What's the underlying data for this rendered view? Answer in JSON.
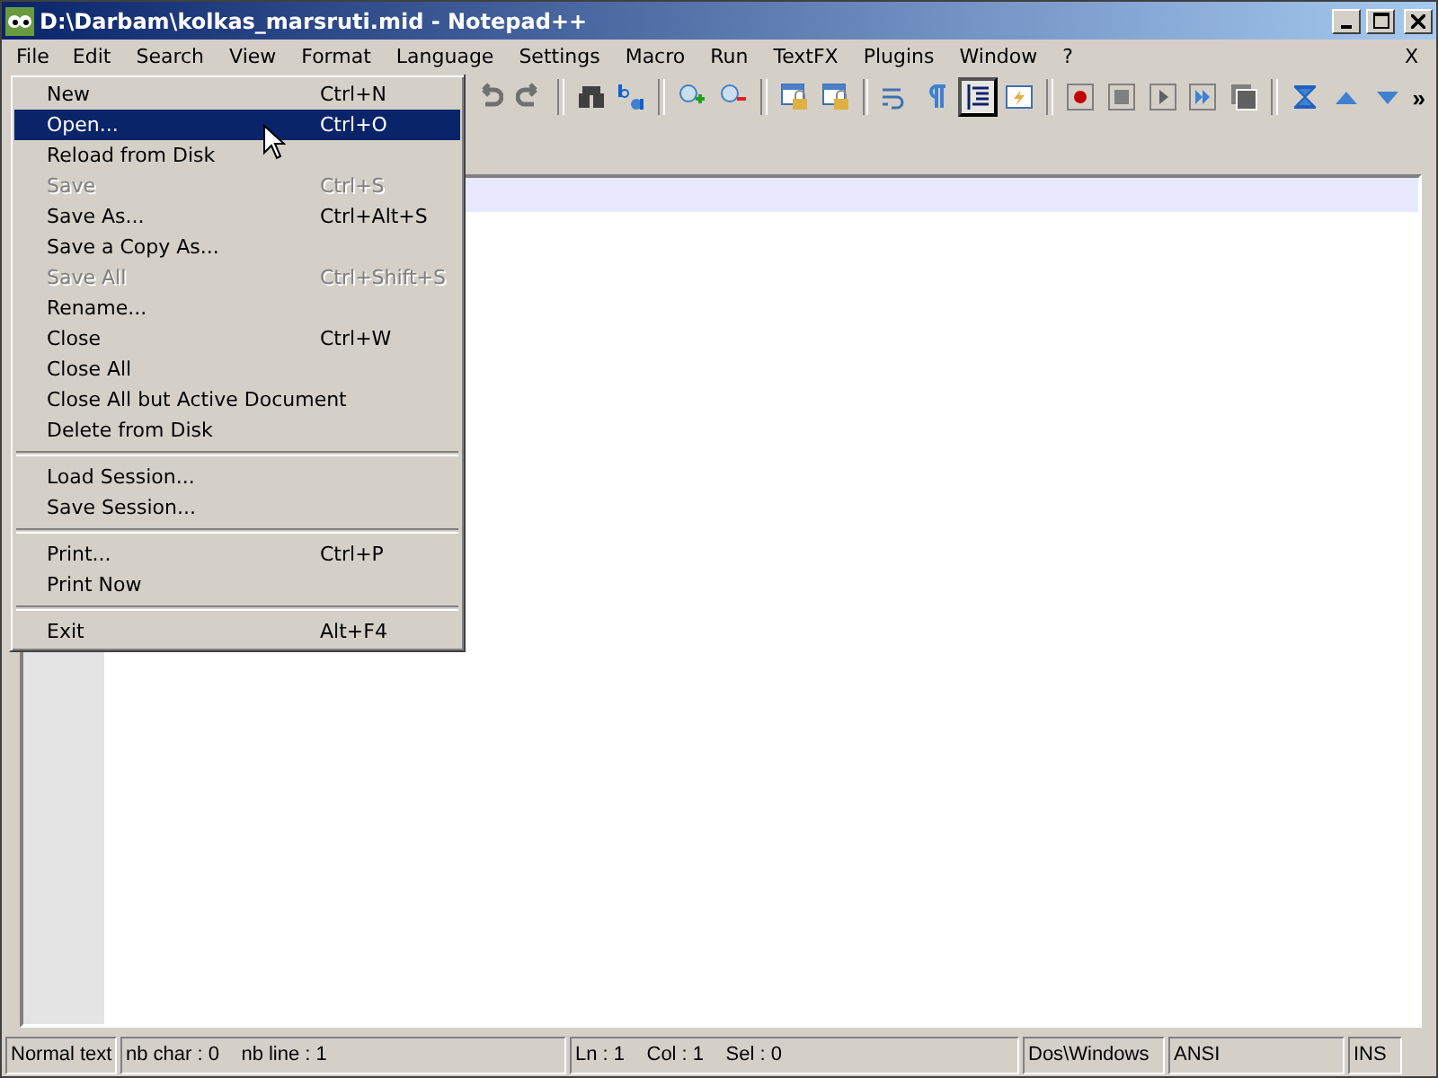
{
  "window": {
    "title": "D:\\Darbam\\kolkas_marsruti.mid - Notepad++"
  },
  "menubar": [
    {
      "label": "File",
      "selected": true
    },
    {
      "label": "Edit",
      "selected": false
    },
    {
      "label": "Search",
      "selected": false
    },
    {
      "label": "View",
      "selected": false
    },
    {
      "label": "Format",
      "selected": false
    },
    {
      "label": "Language",
      "selected": false
    },
    {
      "label": "Settings",
      "selected": false
    },
    {
      "label": "Macro",
      "selected": false
    },
    {
      "label": "Run",
      "selected": false
    },
    {
      "label": "TextFX",
      "selected": false
    },
    {
      "label": "Plugins",
      "selected": false
    },
    {
      "label": "Window",
      "selected": false
    },
    {
      "label": "?",
      "selected": false
    }
  ],
  "menubar_close": "X",
  "toolbar": [
    {
      "kind": "undo",
      "pressed": false
    },
    {
      "kind": "redo",
      "pressed": false
    },
    {
      "kind": "sep"
    },
    {
      "kind": "find",
      "pressed": false
    },
    {
      "kind": "replace",
      "pressed": false
    },
    {
      "kind": "sep"
    },
    {
      "kind": "zoomin",
      "pressed": false
    },
    {
      "kind": "zoomout",
      "pressed": false
    },
    {
      "kind": "sep"
    },
    {
      "kind": "lock",
      "pressed": false
    },
    {
      "kind": "lock2",
      "pressed": false
    },
    {
      "kind": "sep"
    },
    {
      "kind": "wrap",
      "pressed": false
    },
    {
      "kind": "pilcrow",
      "pressed": false
    },
    {
      "kind": "indent",
      "pressed": true
    },
    {
      "kind": "lightning",
      "pressed": false
    },
    {
      "kind": "sep"
    },
    {
      "kind": "record",
      "pressed": false
    },
    {
      "kind": "stop",
      "pressed": false
    },
    {
      "kind": "play",
      "pressed": false
    },
    {
      "kind": "playmulti",
      "pressed": false
    },
    {
      "kind": "savemacro",
      "pressed": false
    },
    {
      "kind": "sep"
    },
    {
      "kind": "sync",
      "pressed": false
    },
    {
      "kind": "up",
      "pressed": false
    },
    {
      "kind": "down",
      "pressed": false
    }
  ],
  "toolbar_more": "»",
  "file_menu": [
    {
      "kind": "item",
      "label": "New",
      "shortcut": "Ctrl+N",
      "disabled": false,
      "selected": false
    },
    {
      "kind": "item",
      "label": "Open...",
      "shortcut": "Ctrl+O",
      "disabled": false,
      "selected": true
    },
    {
      "kind": "item",
      "label": "Reload from Disk",
      "disabled": false,
      "selected": false
    },
    {
      "kind": "item",
      "label": "Save",
      "shortcut": "Ctrl+S",
      "disabled": true,
      "selected": false
    },
    {
      "kind": "item",
      "label": "Save As...",
      "shortcut": "Ctrl+Alt+S",
      "disabled": false,
      "selected": false
    },
    {
      "kind": "item",
      "label": "Save a Copy As...",
      "disabled": false,
      "selected": false
    },
    {
      "kind": "item",
      "label": "Save All",
      "shortcut": "Ctrl+Shift+S",
      "disabled": true,
      "selected": false
    },
    {
      "kind": "item",
      "label": "Rename...",
      "disabled": false,
      "selected": false
    },
    {
      "kind": "item",
      "label": "Close",
      "shortcut": "Ctrl+W",
      "disabled": false,
      "selected": false
    },
    {
      "kind": "item",
      "label": "Close All",
      "disabled": false,
      "selected": false
    },
    {
      "kind": "item",
      "label": "Close All but Active Document",
      "disabled": false,
      "selected": false
    },
    {
      "kind": "item",
      "label": "Delete from Disk",
      "disabled": false,
      "selected": false
    },
    {
      "kind": "separator"
    },
    {
      "kind": "item",
      "label": "Load Session...",
      "disabled": false,
      "selected": false
    },
    {
      "kind": "item",
      "label": "Save Session...",
      "disabled": false,
      "selected": false
    },
    {
      "kind": "separator"
    },
    {
      "kind": "item",
      "label": "Print...",
      "shortcut": "Ctrl+P",
      "disabled": false,
      "selected": false
    },
    {
      "kind": "item",
      "label": "Print Now",
      "disabled": false,
      "selected": false
    },
    {
      "kind": "separator"
    },
    {
      "kind": "item",
      "label": "Exit",
      "shortcut": "Alt+F4",
      "disabled": false,
      "selected": false
    }
  ],
  "status_bar": [
    "Normal text",
    "nb char : 0    nb line : 1",
    "Ln : 1    Col : 1    Sel : 0",
    "Dos\\Windows",
    "ANSI",
    "INS"
  ]
}
